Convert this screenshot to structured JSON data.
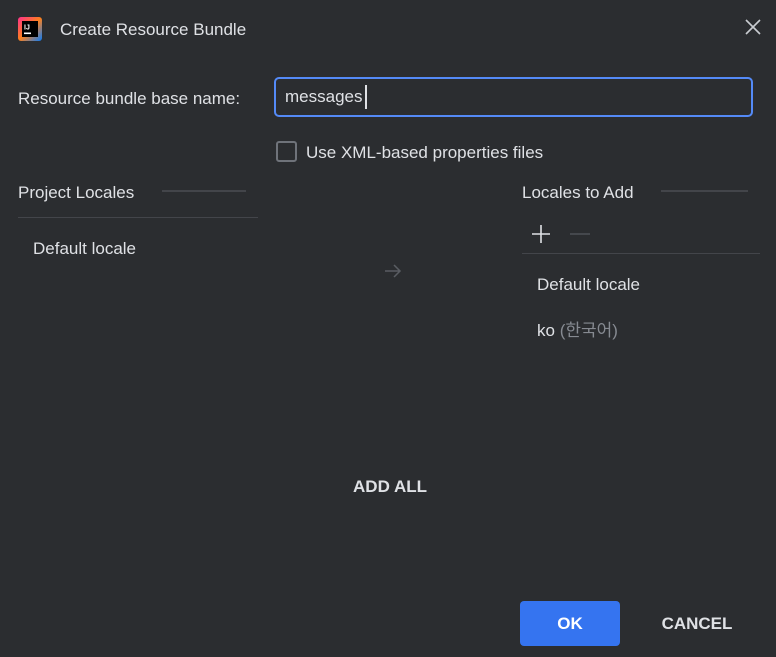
{
  "dialog": {
    "title": "Create Resource Bundle",
    "app_icon": "intellij-idea-icon",
    "close_icon": "close-icon"
  },
  "base_name": {
    "label": "Resource bundle base name:",
    "value": "messages"
  },
  "xml_option": {
    "label": "Use XML-based properties files",
    "checked": false
  },
  "project_locales": {
    "title": "Project Locales",
    "items": [
      "Default locale"
    ]
  },
  "transfer": {
    "arrow_icon": "arrow-right-icon",
    "add_all_label": "ADD ALL"
  },
  "locales_to_add": {
    "title": "Locales to Add",
    "toolbar": {
      "add_icon": "plus-icon",
      "remove_icon": "minus-icon"
    },
    "items": [
      {
        "code": "Default locale",
        "native": ""
      },
      {
        "code": "ko",
        "native": "(한국어)"
      }
    ]
  },
  "footer": {
    "ok_label": "OK",
    "cancel_label": "CANCEL"
  },
  "colors": {
    "background": "#2b2d30",
    "accent": "#3574f0",
    "focus_border": "#548af7",
    "text": "#dfe1e5",
    "muted_text": "#868a91"
  }
}
